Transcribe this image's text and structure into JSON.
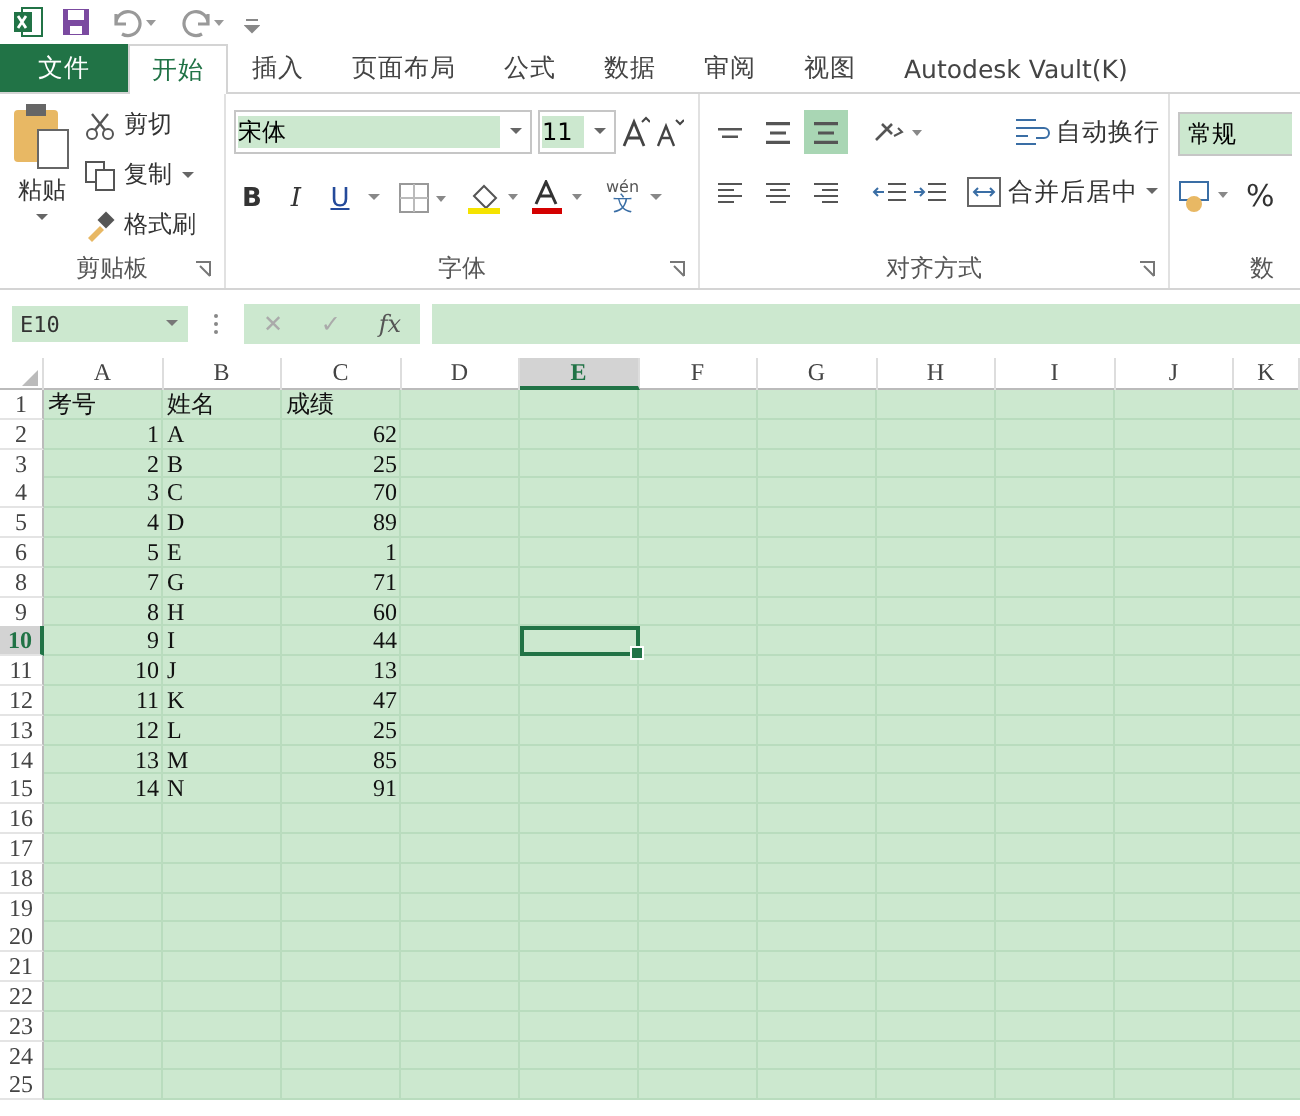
{
  "tabs": [
    {
      "label": "文件",
      "kind": "file",
      "selected": false
    },
    {
      "label": "开始",
      "kind": "tab",
      "selected": true
    },
    {
      "label": "插入",
      "kind": "tab",
      "selected": false
    },
    {
      "label": "页面布局",
      "kind": "tab",
      "selected": false
    },
    {
      "label": "公式",
      "kind": "tab",
      "selected": false
    },
    {
      "label": "数据",
      "kind": "tab",
      "selected": false
    },
    {
      "label": "审阅",
      "kind": "tab",
      "selected": false
    },
    {
      "label": "视图",
      "kind": "tab",
      "selected": false
    },
    {
      "label": "Autodesk Vault(K)",
      "kind": "tab",
      "selected": false
    }
  ],
  "clipboard": {
    "paste": "粘贴",
    "cut": "剪切",
    "copy": "复制",
    "format_painter": "格式刷",
    "group_label": "剪贴板"
  },
  "font": {
    "name": "宋体",
    "size": "11",
    "bold": "B",
    "italic": "I",
    "underline": "U",
    "phonetic_ruby": "wén",
    "phonetic_char": "文",
    "group_label": "字体"
  },
  "alignment": {
    "vertical": [
      {
        "selected": false
      },
      {
        "selected": false
      },
      {
        "selected": true
      }
    ],
    "wrap_text": "自动换行",
    "merge_center": "合并后居中",
    "group_label": "对齐方式"
  },
  "number": {
    "format": "常规",
    "percent": "%",
    "group_label": "数"
  },
  "formula_bar": {
    "name_box": "E10",
    "cancel": "✕",
    "enter": "✓",
    "function": "fx"
  },
  "sheet": {
    "columns": [
      {
        "label": "A",
        "selected": false
      },
      {
        "label": "B",
        "selected": false
      },
      {
        "label": "C",
        "selected": false
      },
      {
        "label": "D",
        "selected": false
      },
      {
        "label": "E",
        "selected": true
      },
      {
        "label": "F",
        "selected": false
      },
      {
        "label": "G",
        "selected": false
      },
      {
        "label": "H",
        "selected": false
      },
      {
        "label": "I",
        "selected": false
      },
      {
        "label": "J",
        "selected": false
      },
      {
        "label": "K",
        "selected": false
      }
    ],
    "rows": [
      {
        "label": "1",
        "selected": false,
        "cells": [
          "考号",
          "姓名",
          "成绩"
        ]
      },
      {
        "label": "2",
        "selected": false,
        "cells": [
          "1",
          "A",
          "62"
        ]
      },
      {
        "label": "3",
        "selected": false,
        "cells": [
          "2",
          "B",
          "25"
        ]
      },
      {
        "label": "4",
        "selected": false,
        "cells": [
          "3",
          "C",
          "70"
        ]
      },
      {
        "label": "5",
        "selected": false,
        "cells": [
          "4",
          "D",
          "89"
        ]
      },
      {
        "label": "6",
        "selected": false,
        "cells": [
          "5",
          "E",
          "1"
        ]
      },
      {
        "label": "8",
        "selected": false,
        "cells": [
          "7",
          "G",
          "71"
        ]
      },
      {
        "label": "9",
        "selected": false,
        "cells": [
          "8",
          "H",
          "60"
        ]
      },
      {
        "label": "10",
        "selected": true,
        "cells": [
          "9",
          "I",
          "44"
        ]
      },
      {
        "label": "11",
        "selected": false,
        "cells": [
          "10",
          "J",
          "13"
        ]
      },
      {
        "label": "12",
        "selected": false,
        "cells": [
          "11",
          "K",
          "47"
        ]
      },
      {
        "label": "13",
        "selected": false,
        "cells": [
          "12",
          "L",
          "25"
        ]
      },
      {
        "label": "14",
        "selected": false,
        "cells": [
          "13",
          "M",
          "85"
        ]
      },
      {
        "label": "15",
        "selected": false,
        "cells": [
          "14",
          "N",
          "91"
        ]
      },
      {
        "label": "16",
        "selected": false
      },
      {
        "label": "17",
        "selected": false
      },
      {
        "label": "18",
        "selected": false
      },
      {
        "label": "19",
        "selected": false
      },
      {
        "label": "20",
        "selected": false
      },
      {
        "label": "21",
        "selected": false
      },
      {
        "label": "22",
        "selected": false
      },
      {
        "label": "23",
        "selected": false
      },
      {
        "label": "24",
        "selected": false
      },
      {
        "label": "25",
        "selected": false
      }
    ]
  }
}
